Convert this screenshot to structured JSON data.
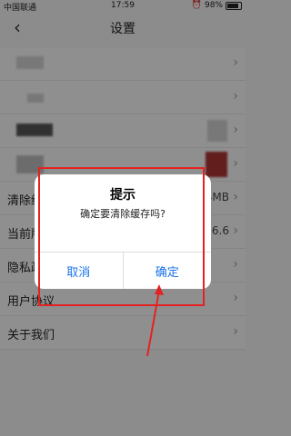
{
  "status_bar": {
    "carrier": "中国联通",
    "time": "17:59",
    "battery": "98%"
  },
  "nav": {
    "title": "设置",
    "back_icon": "chevron-left-icon"
  },
  "settings_rows": [
    {
      "label": "",
      "value": ""
    },
    {
      "label": "",
      "value": ""
    },
    {
      "label": "",
      "value": ""
    },
    {
      "label": "",
      "value": ""
    },
    {
      "label": "清除缓存",
      "value": "1.74MB"
    },
    {
      "label": "当前版本",
      "value": "6.6.6"
    },
    {
      "label": "隐私政策",
      "value": ""
    },
    {
      "label": "用户协议",
      "value": ""
    },
    {
      "label": "关于我们",
      "value": ""
    }
  ],
  "dialog": {
    "title": "提示",
    "message": "确定要清除缓存吗?",
    "cancel_label": "取消",
    "confirm_label": "确定"
  },
  "colors": {
    "accent": "#1a73e8",
    "annotation": "#e52222"
  }
}
